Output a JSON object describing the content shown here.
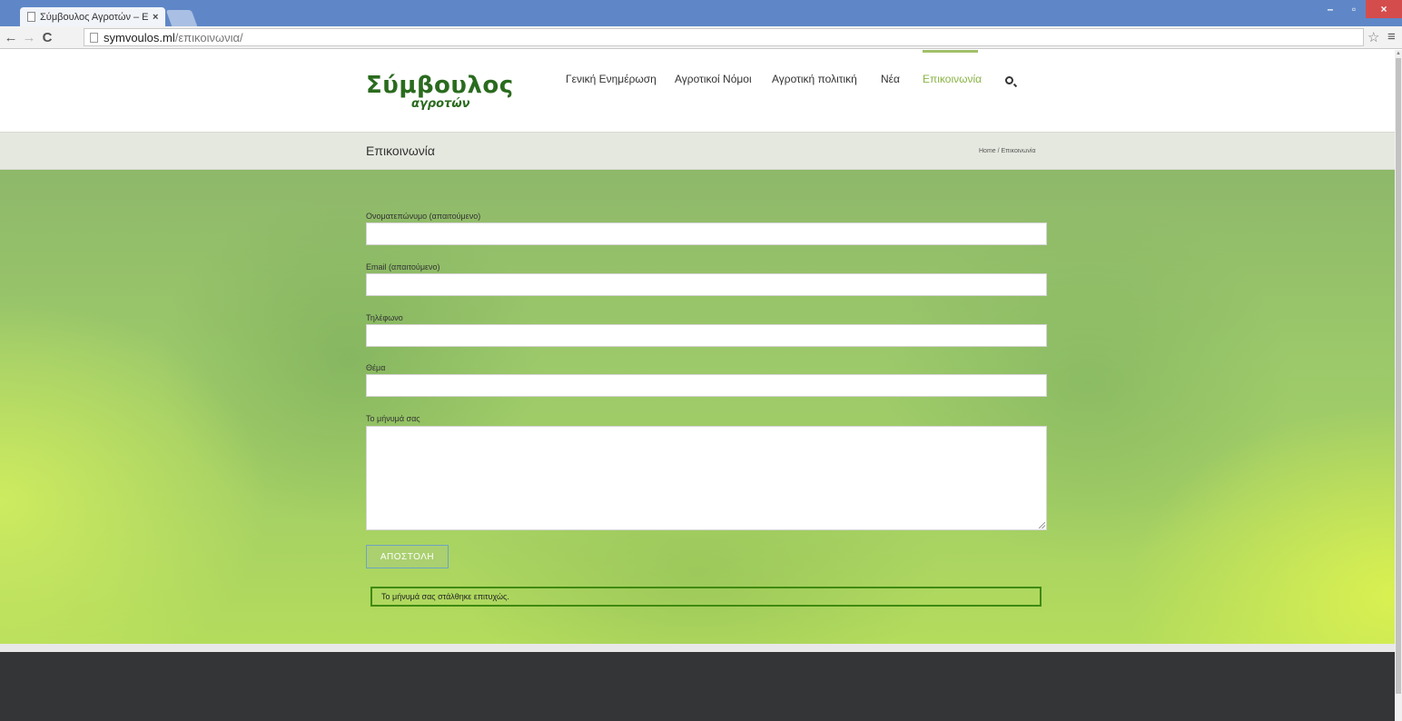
{
  "browser": {
    "tab_title": "Σύμβουλος Αγροτών – Επ",
    "tab_close": "×",
    "url_host": "symvoulos.ml",
    "url_path": "/επικοινωνια/",
    "controls": {
      "back": "←",
      "forward": "→",
      "reload": "C",
      "star": "☆",
      "menu": "≡",
      "minimize": "–",
      "restore": "▫",
      "close": "×"
    }
  },
  "site": {
    "logo_main": "Σύμβουλος",
    "logo_sub": "αγροτών",
    "nav": [
      {
        "label": "Γενική Ενημέρωση",
        "active": false
      },
      {
        "label": "Αγροτικοί Νόμοι",
        "active": false
      },
      {
        "label": "Αγροτική πολιτική",
        "active": false
      },
      {
        "label": "Νέα",
        "active": false
      },
      {
        "label": "Επικοινωνία",
        "active": true
      }
    ],
    "accent_color": "#8ab446"
  },
  "page": {
    "title": "Επικοινωνία",
    "breadcrumb": "Home / Επικοινωνία"
  },
  "form": {
    "name_label": "Ονοματεπώνυμο (απαιτούμενο)",
    "name_value": "",
    "email_label": "Email (απαιτούμενο)",
    "email_value": "",
    "phone_label": "Τηλέφωνο",
    "phone_value": "",
    "subject_label": "Θέμα",
    "subject_value": "",
    "message_label": "Το μήνυμά σας",
    "message_value": "",
    "submit_label": "ΑΠΟΣΤΟΛΗ",
    "success_message": "Το μήνυμά σας στάλθηκε επιτυχώς."
  }
}
